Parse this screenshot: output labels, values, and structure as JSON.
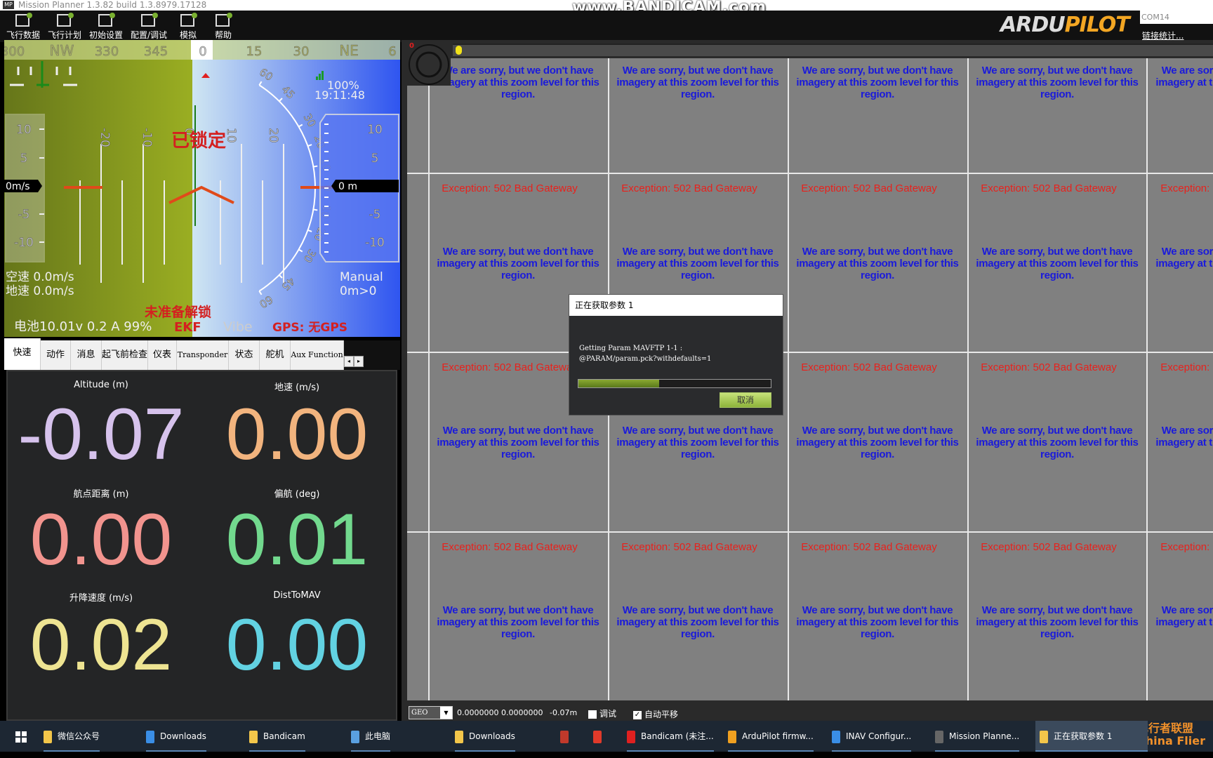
{
  "window": {
    "title": "Mission Planner 1.3.82 build 1.3.8979.17128",
    "app_icon": "MP",
    "recorder_watermark": "www.BANDICAM.com"
  },
  "toolbar": {
    "items": [
      {
        "label": "飞行数据",
        "icon": "flight-data-icon"
      },
      {
        "label": "飞行计划",
        "icon": "flight-plan-icon"
      },
      {
        "label": "初始设置",
        "icon": "initial-setup-icon"
      },
      {
        "label": "配置/调试",
        "icon": "config-tuning-icon"
      },
      {
        "label": "模拟",
        "icon": "simulation-icon"
      },
      {
        "label": "帮助",
        "icon": "help-icon"
      }
    ],
    "logo_text": "ARDUPILOT",
    "port": "COM14",
    "link_stats": "链接统计..."
  },
  "hud": {
    "heading_labels": [
      "300",
      "NW",
      "330",
      "345",
      "0",
      "15",
      "30",
      "NE",
      "6"
    ],
    "heading": "0",
    "speed_ticks": [
      "10",
      "5",
      "-5",
      "-10"
    ],
    "speed_value": "0m/s",
    "alt_ticks": [
      "10",
      "5",
      "-5",
      "-10"
    ],
    "alt_value": "0 m",
    "pitch_labels": [
      "-20",
      "-10",
      "0",
      "10",
      "20"
    ],
    "roll_labels": [
      "60",
      "45",
      "30",
      "20",
      "10",
      "0",
      "10",
      "20",
      "30",
      "45",
      "60"
    ],
    "lock_status": "已锁定",
    "link_quality": "100%",
    "time": "19:11:48",
    "airspeed": "空速 0.0m/s",
    "groundspeed": "地速 0.0m/s",
    "mode": "Manual",
    "wp_info": "0m>0",
    "arm_status": "未准备解锁",
    "battery": "电池10.01v 0.2 A 99%",
    "ekf": "EKF",
    "vibe": "Vibe",
    "gps": "GPS: 无GPS",
    "colors": {
      "ground": "#7a8a1a",
      "sky": "#4d6ef0",
      "warning": "#d42020"
    }
  },
  "tabs": {
    "items": [
      "快速",
      "动作",
      "消息",
      "起飞前检查",
      "仪表",
      "Transponder",
      "状态",
      "舵机",
      "Aux Function"
    ],
    "selected": "快速"
  },
  "quick": {
    "items": [
      {
        "label": "Altitude (m)",
        "value": "-0.07",
        "color": "#d6c2ec"
      },
      {
        "label": "地速 (m/s)",
        "value": "0.00",
        "color": "#f2b47e"
      },
      {
        "label": "航点距离 (m)",
        "value": "0.00",
        "color": "#f2948e"
      },
      {
        "label": "偏航 (deg)",
        "value": "0.01",
        "color": "#72d98e"
      },
      {
        "label": "升降速度 (m/s)",
        "value": "0.02",
        "color": "#eee492"
      },
      {
        "label": "DistToMAV",
        "value": "0.00",
        "color": "#62d2e2"
      }
    ]
  },
  "map": {
    "tile_error": "Exception: 502 Bad Gateway",
    "no_imagery": "We are sorry, but we don't have imagery at this zoom level for this region.",
    "compass_value": "0"
  },
  "map_status": {
    "projection": "GEO",
    "coords": "0.0000000 0.0000000",
    "altitude": "-0.07m",
    "debug_label": "调试",
    "debug_checked": false,
    "autopan_label": "自动平移",
    "autopan_checked": true
  },
  "dialog": {
    "title": "正在获取参数 1",
    "line1": "Getting Param MAVFTP 1-1 :",
    "line2": "@PARAM/param.pck?withdefaults=1",
    "progress": 0.42,
    "cancel": "取消"
  },
  "taskbar": {
    "items": [
      {
        "label": "微信公众号",
        "color": "#f3c64a"
      },
      {
        "label": "Downloads",
        "color": "#3a8ee6"
      },
      {
        "label": "Bandicam",
        "color": "#f3c64a"
      },
      {
        "label": "此电脑",
        "color": "#5aa0e0"
      },
      {
        "label": "Downloads",
        "color": "#f3c64a"
      },
      {
        "label": "",
        "color": "#c0392b"
      },
      {
        "label": "",
        "color": "#e03a2a"
      },
      {
        "label": "Bandicam (未注...",
        "color": "#e02020"
      },
      {
        "label": "ArduPilot firmw...",
        "color": "#f0a020"
      },
      {
        "label": "INAV Configur...",
        "color": "#3a8ee6"
      },
      {
        "label": "Mission Planne...",
        "color": "#666"
      },
      {
        "label": "正在获取参数 1",
        "color": "#f3c64a"
      }
    ],
    "watermark": "飞行者联盟 China Flier"
  }
}
